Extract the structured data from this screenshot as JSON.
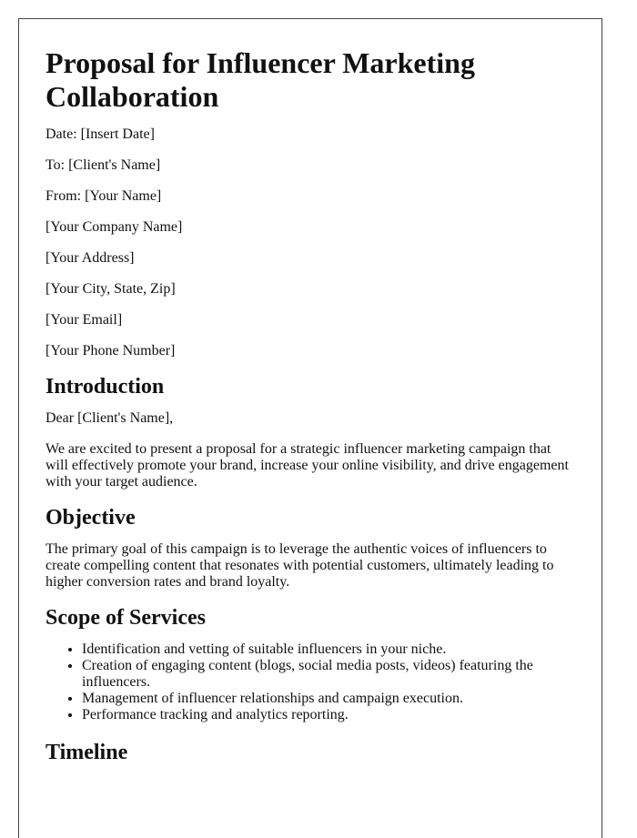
{
  "title": "Proposal for Influencer Marketing Collaboration",
  "meta": [
    "Date: [Insert Date]",
    "To: [Client's Name]",
    "From: [Your Name]",
    "[Your Company Name]",
    "[Your Address]",
    "[Your City, State, Zip]",
    "[Your Email]",
    "[Your Phone Number]"
  ],
  "introduction": {
    "heading": "Introduction",
    "salutation": "Dear [Client's Name],",
    "body": "We are excited to present a proposal for a strategic influencer marketing campaign that will effectively promote your brand, increase your online visibility, and drive engagement with your target audience."
  },
  "objective": {
    "heading": "Objective",
    "body": "The primary goal of this campaign is to leverage the authentic voices of influencers to create compelling content that resonates with potential customers, ultimately leading to higher conversion rates and brand loyalty."
  },
  "scope": {
    "heading": "Scope of Services",
    "items": [
      "Identification and vetting of suitable influencers in your niche.",
      "Creation of engaging content (blogs, social media posts, videos) featuring the influencers.",
      "Management of influencer relationships and campaign execution.",
      "Performance tracking and analytics reporting."
    ]
  },
  "timeline": {
    "heading": "Timeline"
  }
}
